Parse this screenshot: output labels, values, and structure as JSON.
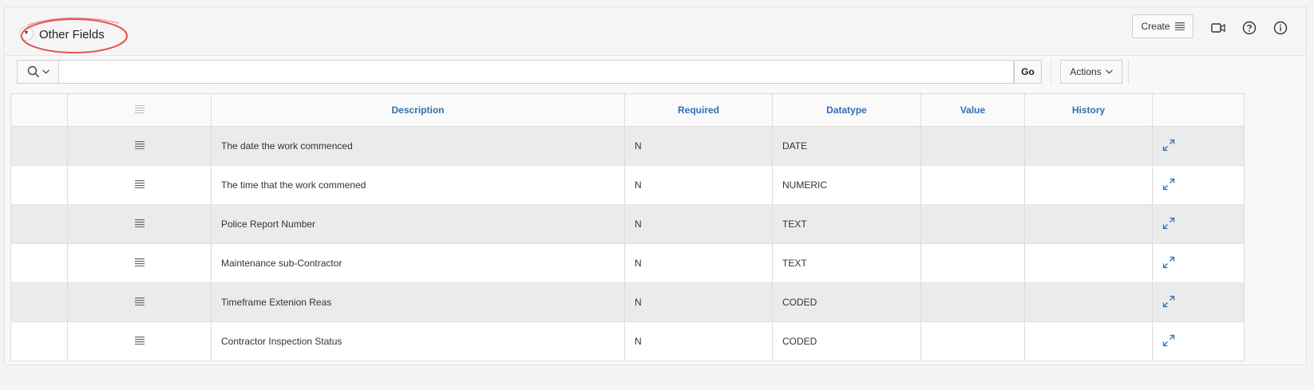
{
  "region": {
    "title": "Other Fields",
    "collapse_icon": "caret-down-icon",
    "annotation_color": "#e8504f"
  },
  "header_buttons": {
    "create_label": "Create",
    "icons": [
      "video-camera-icon",
      "help-circle-icon",
      "info-circle-icon"
    ]
  },
  "toolbar": {
    "search_value": "",
    "search_placeholder": "",
    "go_label": "Go",
    "actions_label": "Actions"
  },
  "table": {
    "columns": [
      "Description",
      "Required",
      "Datatype",
      "Value",
      "History"
    ],
    "rows": [
      {
        "description": "The date the work commenced",
        "required": "N",
        "datatype": "DATE",
        "value": "",
        "history": ""
      },
      {
        "description": "The time that the work commened",
        "required": "N",
        "datatype": "NUMERIC",
        "value": "",
        "history": ""
      },
      {
        "description": "Police Report Number",
        "required": "N",
        "datatype": "TEXT",
        "value": "",
        "history": ""
      },
      {
        "description": "Maintenance sub-Contractor",
        "required": "N",
        "datatype": "TEXT",
        "value": "",
        "history": ""
      },
      {
        "description": "Timeframe Extenion Reas",
        "required": "N",
        "datatype": "CODED",
        "value": "",
        "history": ""
      },
      {
        "description": "Contractor Inspection Status",
        "required": "N",
        "datatype": "CODED",
        "value": "",
        "history": ""
      }
    ]
  },
  "colors": {
    "link_blue": "#2f6fb3",
    "row_alt": "#ebebeb"
  }
}
